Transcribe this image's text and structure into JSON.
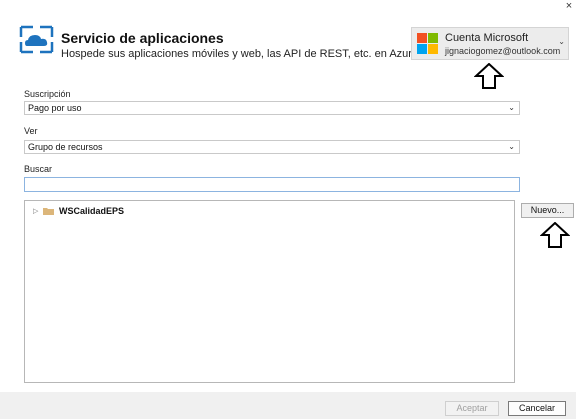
{
  "window": {
    "close_glyph": "×"
  },
  "header": {
    "title": "Servicio de aplicaciones",
    "subtitle": "Hospede sus aplicaciones móviles y web, las API de REST, etc. en Azure",
    "icon": "cloud-app-service-icon"
  },
  "account": {
    "name": "Cuenta Microsoft",
    "email": "jignaciogomez@outlook.com",
    "logo_colors": [
      "#f25022",
      "#7fba00",
      "#00a4ef",
      "#ffb900"
    ],
    "chevron": "⌄"
  },
  "subscription": {
    "label": "Suscripción",
    "value": "Pago por uso"
  },
  "view": {
    "label": "Ver",
    "value": "Grupo de recursos"
  },
  "search": {
    "label": "Buscar",
    "value": "",
    "placeholder": ""
  },
  "tree": {
    "items": [
      {
        "label": "WSCalidadEPS",
        "expanded": false,
        "icon": "folder-icon"
      }
    ]
  },
  "buttons": {
    "new_label": "Nuevo...",
    "accept_label": "Aceptar",
    "cancel_label": "Cancelar"
  },
  "colors": {
    "accent": "#0078d7",
    "folder": "#dcb67a",
    "arrow": "#000000"
  }
}
